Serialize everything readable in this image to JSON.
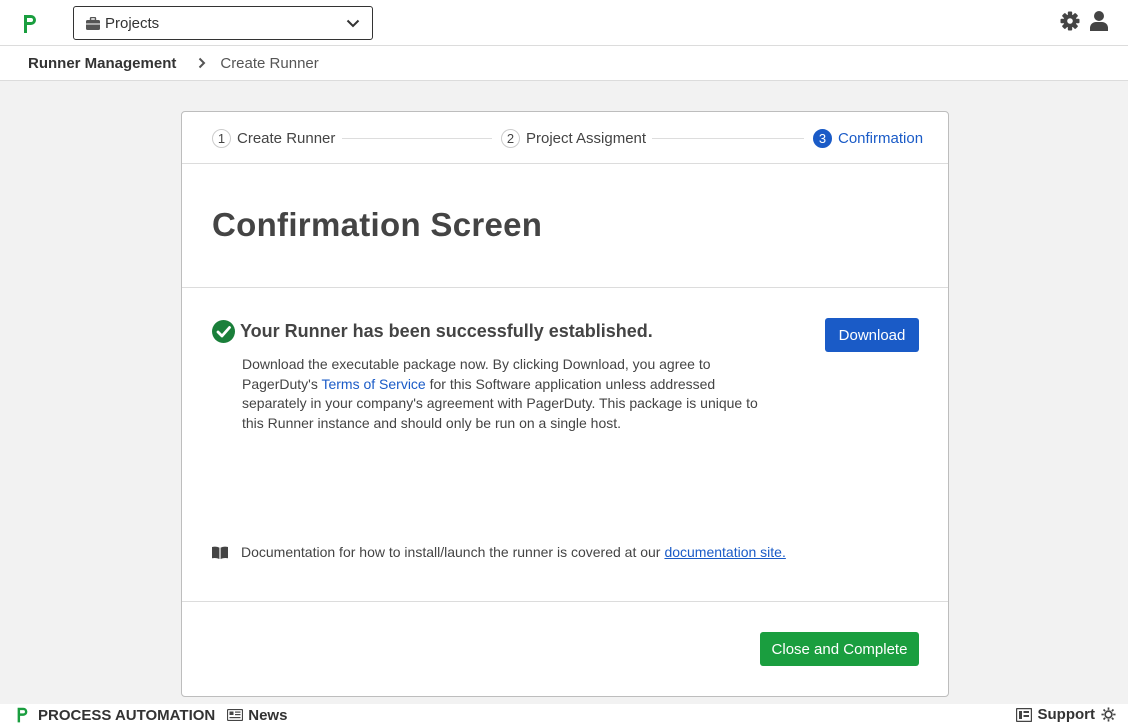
{
  "header": {
    "project_selector": "Projects"
  },
  "breadcrumb": {
    "root": "Runner Management",
    "current": "Create Runner"
  },
  "stepper": {
    "steps": [
      {
        "num": "1",
        "label": "Create Runner"
      },
      {
        "num": "2",
        "label": "Project Assigment"
      },
      {
        "num": "3",
        "label": "Confirmation"
      }
    ]
  },
  "main": {
    "title": "Confirmation Screen",
    "success_heading": "Your Runner has been successfully established.",
    "desc_part1": "Download the executable package now. By clicking Download, you agree to PagerDuty's ",
    "tos_link": "Terms of Service",
    "desc_part2": " for this Software application unless addressed separately in your company's agreement with PagerDuty. This package is unique to this Runner instance and should only be run on a single host.",
    "download_label": "Download",
    "docs_text": "Documentation for how to install/launch the runner is covered at our",
    "docs_link": "documentation site.",
    "close_label": "Close and Complete"
  },
  "footer": {
    "product": "PROCESS AUTOMATION",
    "news": "News",
    "support": "Support"
  },
  "colors": {
    "brand_green": "#1a9e3f",
    "primary_blue": "#1a5bc7"
  }
}
